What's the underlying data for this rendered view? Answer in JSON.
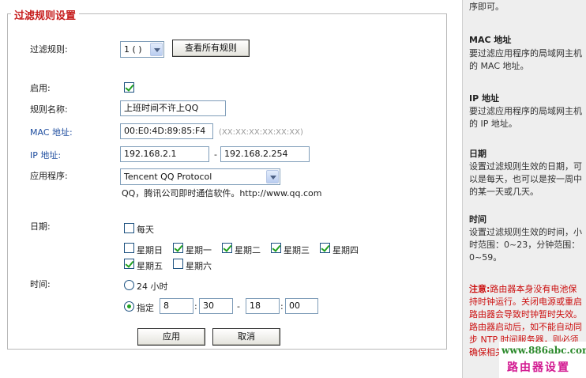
{
  "section_title": "过滤规则设置",
  "filter_rule": {
    "label": "过滤规则:",
    "selected": "1 ( )",
    "view_all_button": "查看所有规则"
  },
  "enable": {
    "label": "启用:",
    "checked": true
  },
  "rule_name": {
    "label": "规则名称:",
    "value": "上班时间不许上QQ"
  },
  "mac": {
    "label": "MAC 地址:",
    "value": "00:E0:4D:89:85:F4",
    "hint": "(XX:XX:XX:XX:XX:XX)"
  },
  "ip": {
    "label": "IP 地址:",
    "start": "192.168.2.1",
    "separator": "-",
    "end": "192.168.2.254"
  },
  "app": {
    "label": "应用程序:",
    "selected": "Tencent QQ Protocol",
    "description": "QQ，腾讯公司即时通信软件。http://www.qq.com"
  },
  "date": {
    "label": "日期:",
    "everyday": {
      "label": "每天",
      "checked": false
    },
    "days": [
      {
        "label": "星期日",
        "checked": false
      },
      {
        "label": "星期一",
        "checked": true
      },
      {
        "label": "星期二",
        "checked": true
      },
      {
        "label": "星期三",
        "checked": true
      },
      {
        "label": "星期四",
        "checked": true
      },
      {
        "label": "星期五",
        "checked": true
      },
      {
        "label": "星期六",
        "checked": false
      }
    ]
  },
  "time": {
    "label": "时间:",
    "option_24h": "24 小时",
    "option_custom": "指定",
    "selected": "custom",
    "start_hour": "8",
    "start_min": "30",
    "dash": "-",
    "end_hour": "18",
    "end_min": "00",
    "colon": ":"
  },
  "buttons": {
    "apply": "应用",
    "cancel": "取消"
  },
  "help": {
    "intro": "序即可。",
    "mac_title": "MAC 地址",
    "mac_text": "要过滤应用程序的局域网主机的 MAC 地址。",
    "ip_title": "IP 地址",
    "ip_text": "要过滤应用程序的局域网主机的 IP 地址。",
    "date_title": "日期",
    "date_text": "设置过滤规则生效的日期，可以是每天，也可以是按一周中的某一天或几天。",
    "time_title": "时间",
    "time_text": "设置过滤规则生效的时间，小时范围：0~23，分钟范围：0~59。",
    "warn_title": "注意:",
    "warn_text": "路由器本身没有电池保持时钟运行。关闭电源或重启路由器会导致时钟暂时失效。路由器启动后，如不能自动同步 NTP 时间服务器，则必须确保相关设置确执行。"
  },
  "watermark": {
    "url": "www.886abc.com",
    "name": "路由器设置"
  }
}
